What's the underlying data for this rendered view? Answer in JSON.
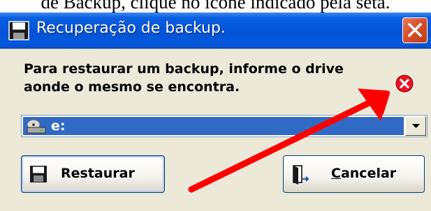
{
  "document": {
    "text": "de Backup, clique no ícone indicado pela seta."
  },
  "window": {
    "title": "Recuperação de backup.",
    "title_icon": "floppy-disk-icon",
    "close_icon": "close-icon"
  },
  "message": {
    "line1": "Para restaurar um backup, informe o drive",
    "line2": "aonde o mesmo se encontra."
  },
  "error_icon": {
    "name": "error-icon",
    "color": "#e81123"
  },
  "drive_select": {
    "value": "e:",
    "icon": "drive-icon",
    "selected_color": "#316ac5"
  },
  "buttons": {
    "restore": {
      "label": "Restaurar",
      "icon": "floppy-disk-icon"
    },
    "cancel": {
      "label_underlined": "C",
      "label_rest": "ancelar",
      "icon": "exit-door-icon"
    }
  },
  "annotation": {
    "name": "red-arrow",
    "color": "#ff0000"
  }
}
